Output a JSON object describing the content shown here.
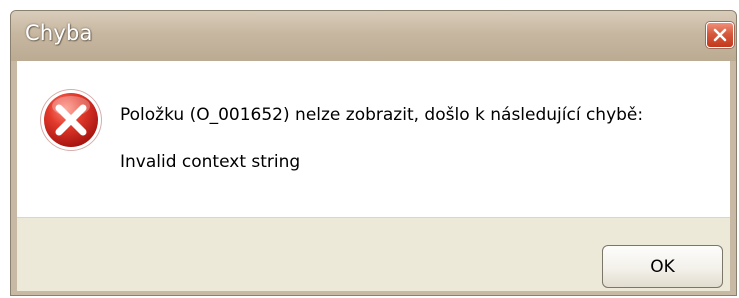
{
  "dialog": {
    "title": "Chyba",
    "message": "Položku (O_001652) nelze zobrazit, došlo k následující chybě:",
    "detail": "Invalid context string",
    "ok_label": "OK"
  },
  "icons": {
    "error": "error-icon",
    "close": "close-icon"
  },
  "colors": {
    "titlebar": "#c7b7a1",
    "close_button": "#d65a3e",
    "error_icon": "#d8261e",
    "footer": "#ece9d8"
  }
}
